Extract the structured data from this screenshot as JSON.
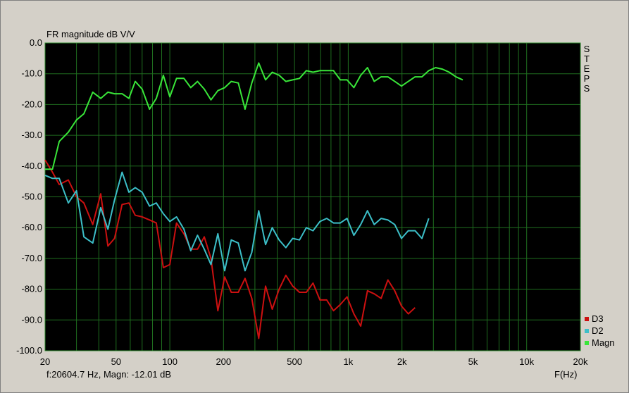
{
  "colors": {
    "plot_bg": "#000000",
    "grid": "#1f6e1f",
    "frame": "#808080",
    "D3": "#cc1010",
    "D2": "#3cbfc8",
    "Magn": "#39e639"
  },
  "status_text": "f:20604.7 Hz, Magn: -12.01 dB",
  "side_label": "STEPS",
  "chart_data": {
    "type": "line",
    "title": "FR magnitude dB V/V",
    "xlabel": "F(Hz)",
    "ylabel": "",
    "x_scale": "log",
    "xlim": [
      20,
      20000
    ],
    "ylim": [
      -100,
      0
    ],
    "grid": true,
    "legend_position": "bottom-right",
    "x_ticks": [
      {
        "v": 20,
        "l": "20"
      },
      {
        "v": 50,
        "l": "50"
      },
      {
        "v": 100,
        "l": "100"
      },
      {
        "v": 200,
        "l": "200"
      },
      {
        "v": 500,
        "l": "500"
      },
      {
        "v": 1000,
        "l": "1k"
      },
      {
        "v": 2000,
        "l": "2k"
      },
      {
        "v": 5000,
        "l": "5k"
      },
      {
        "v": 10000,
        "l": "10k"
      },
      {
        "v": 20000,
        "l": "20k"
      }
    ],
    "y_ticks": [
      {
        "v": 0,
        "l": "0.0"
      },
      {
        "v": -10,
        "l": "-10.0"
      },
      {
        "v": -20,
        "l": "-20.0"
      },
      {
        "v": -30,
        "l": "-30.0"
      },
      {
        "v": -40,
        "l": "-40.0"
      },
      {
        "v": -50,
        "l": "-50.0"
      },
      {
        "v": -60,
        "l": "-60.0"
      },
      {
        "v": -70,
        "l": "-70.0"
      },
      {
        "v": -80,
        "l": "-80.0"
      },
      {
        "v": -90,
        "l": "-90.0"
      },
      {
        "v": -100,
        "l": "-100.0"
      }
    ],
    "series": [
      {
        "name": "D3",
        "color": "#cc1010",
        "points": [
          [
            20,
            -38
          ],
          [
            22,
            -42
          ],
          [
            24,
            -46
          ],
          [
            27,
            -44.5
          ],
          [
            30,
            -50
          ],
          [
            33,
            -52
          ],
          [
            37,
            -59
          ],
          [
            41,
            -49
          ],
          [
            45,
            -66
          ],
          [
            49,
            -63.5
          ],
          [
            54,
            -52.5
          ],
          [
            59,
            -52
          ],
          [
            64,
            -56
          ],
          [
            70,
            -56.5
          ],
          [
            77,
            -57.5
          ],
          [
            84,
            -58.5
          ],
          [
            92,
            -73
          ],
          [
            100,
            -72
          ],
          [
            109,
            -58.5
          ],
          [
            120,
            -62
          ],
          [
            131,
            -67
          ],
          [
            143,
            -67
          ],
          [
            156,
            -63
          ],
          [
            170,
            -70
          ],
          [
            186,
            -87
          ],
          [
            203,
            -76
          ],
          [
            221,
            -81
          ],
          [
            242,
            -81
          ],
          [
            264,
            -76.5
          ],
          [
            288,
            -83
          ],
          [
            315,
            -96
          ],
          [
            344,
            -79
          ],
          [
            375,
            -86.5
          ],
          [
            410,
            -80
          ],
          [
            447,
            -75.5
          ],
          [
            488,
            -79
          ],
          [
            533,
            -81
          ],
          [
            582,
            -81
          ],
          [
            635,
            -78
          ],
          [
            694,
            -83.5
          ],
          [
            757,
            -83.5
          ],
          [
            827,
            -87
          ],
          [
            902,
            -85
          ],
          [
            985,
            -82.5
          ],
          [
            1075,
            -88
          ],
          [
            1174,
            -92
          ],
          [
            1282,
            -80.5
          ],
          [
            1399,
            -81.5
          ],
          [
            1528,
            -83
          ],
          [
            1668,
            -77
          ],
          [
            1821,
            -80.5
          ],
          [
            1988,
            -85.5
          ],
          [
            2171,
            -88
          ],
          [
            2370,
            -86
          ]
        ]
      },
      {
        "name": "D2",
        "color": "#3cbfc8",
        "points": [
          [
            20,
            -43
          ],
          [
            22,
            -44
          ],
          [
            24,
            -44
          ],
          [
            27,
            -52
          ],
          [
            30,
            -48
          ],
          [
            33,
            -63
          ],
          [
            37,
            -65
          ],
          [
            41,
            -53.5
          ],
          [
            45,
            -60.5
          ],
          [
            49,
            -51
          ],
          [
            54,
            -42
          ],
          [
            59,
            -48.5
          ],
          [
            64,
            -47
          ],
          [
            70,
            -48.5
          ],
          [
            77,
            -53
          ],
          [
            84,
            -52
          ],
          [
            92,
            -55.5
          ],
          [
            100,
            -58
          ],
          [
            109,
            -56.5
          ],
          [
            120,
            -60.5
          ],
          [
            131,
            -67.5
          ],
          [
            143,
            -62.5
          ],
          [
            156,
            -67
          ],
          [
            170,
            -72
          ],
          [
            186,
            -62
          ],
          [
            203,
            -74
          ],
          [
            221,
            -64
          ],
          [
            242,
            -65
          ],
          [
            264,
            -74
          ],
          [
            288,
            -68
          ],
          [
            315,
            -54.5
          ],
          [
            344,
            -65.5
          ],
          [
            375,
            -60
          ],
          [
            410,
            -64
          ],
          [
            447,
            -66.5
          ],
          [
            488,
            -63.5
          ],
          [
            533,
            -64
          ],
          [
            582,
            -60
          ],
          [
            635,
            -61
          ],
          [
            694,
            -58
          ],
          [
            757,
            -57
          ],
          [
            827,
            -58.5
          ],
          [
            902,
            -58.5
          ],
          [
            985,
            -57
          ],
          [
            1075,
            -62.5
          ],
          [
            1174,
            -59
          ],
          [
            1282,
            -54.5
          ],
          [
            1399,
            -59
          ],
          [
            1528,
            -57
          ],
          [
            1668,
            -57.5
          ],
          [
            1821,
            -59
          ],
          [
            1988,
            -63.5
          ],
          [
            2171,
            -61
          ],
          [
            2370,
            -61
          ],
          [
            2588,
            -63.5
          ],
          [
            2826,
            -57
          ]
        ]
      },
      {
        "name": "Magn",
        "color": "#39e639",
        "points": [
          [
            20,
            -41
          ],
          [
            22,
            -41
          ],
          [
            24,
            -32
          ],
          [
            27,
            -29
          ],
          [
            30,
            -25
          ],
          [
            33,
            -23
          ],
          [
            37,
            -16
          ],
          [
            41,
            -18
          ],
          [
            45,
            -16
          ],
          [
            49,
            -16.5
          ],
          [
            54,
            -16.5
          ],
          [
            59,
            -18
          ],
          [
            64,
            -12.5
          ],
          [
            70,
            -15
          ],
          [
            77,
            -21.5
          ],
          [
            84,
            -18
          ],
          [
            92,
            -10.5
          ],
          [
            100,
            -17.5
          ],
          [
            109,
            -11.5
          ],
          [
            120,
            -11.5
          ],
          [
            131,
            -14.5
          ],
          [
            143,
            -12.5
          ],
          [
            156,
            -15
          ],
          [
            170,
            -18.5
          ],
          [
            186,
            -15.5
          ],
          [
            203,
            -14.5
          ],
          [
            221,
            -12.5
          ],
          [
            242,
            -13
          ],
          [
            264,
            -21.5
          ],
          [
            288,
            -13
          ],
          [
            315,
            -6.5
          ],
          [
            344,
            -12
          ],
          [
            375,
            -9.5
          ],
          [
            410,
            -10.5
          ],
          [
            447,
            -12.5
          ],
          [
            488,
            -12
          ],
          [
            533,
            -11.5
          ],
          [
            582,
            -9
          ],
          [
            635,
            -9.5
          ],
          [
            694,
            -9
          ],
          [
            757,
            -9
          ],
          [
            827,
            -9
          ],
          [
            902,
            -12
          ],
          [
            985,
            -12
          ],
          [
            1075,
            -14.5
          ],
          [
            1174,
            -10.5
          ],
          [
            1282,
            -8
          ],
          [
            1399,
            -12.5
          ],
          [
            1528,
            -11
          ],
          [
            1668,
            -11
          ],
          [
            1821,
            -12.5
          ],
          [
            1988,
            -14
          ],
          [
            2171,
            -12.5
          ],
          [
            2370,
            -11
          ],
          [
            2588,
            -11
          ],
          [
            2826,
            -9
          ],
          [
            3085,
            -8
          ],
          [
            3368,
            -8.5
          ],
          [
            3677,
            -9.5
          ],
          [
            4014,
            -11
          ],
          [
            4382,
            -12
          ]
        ]
      }
    ]
  }
}
